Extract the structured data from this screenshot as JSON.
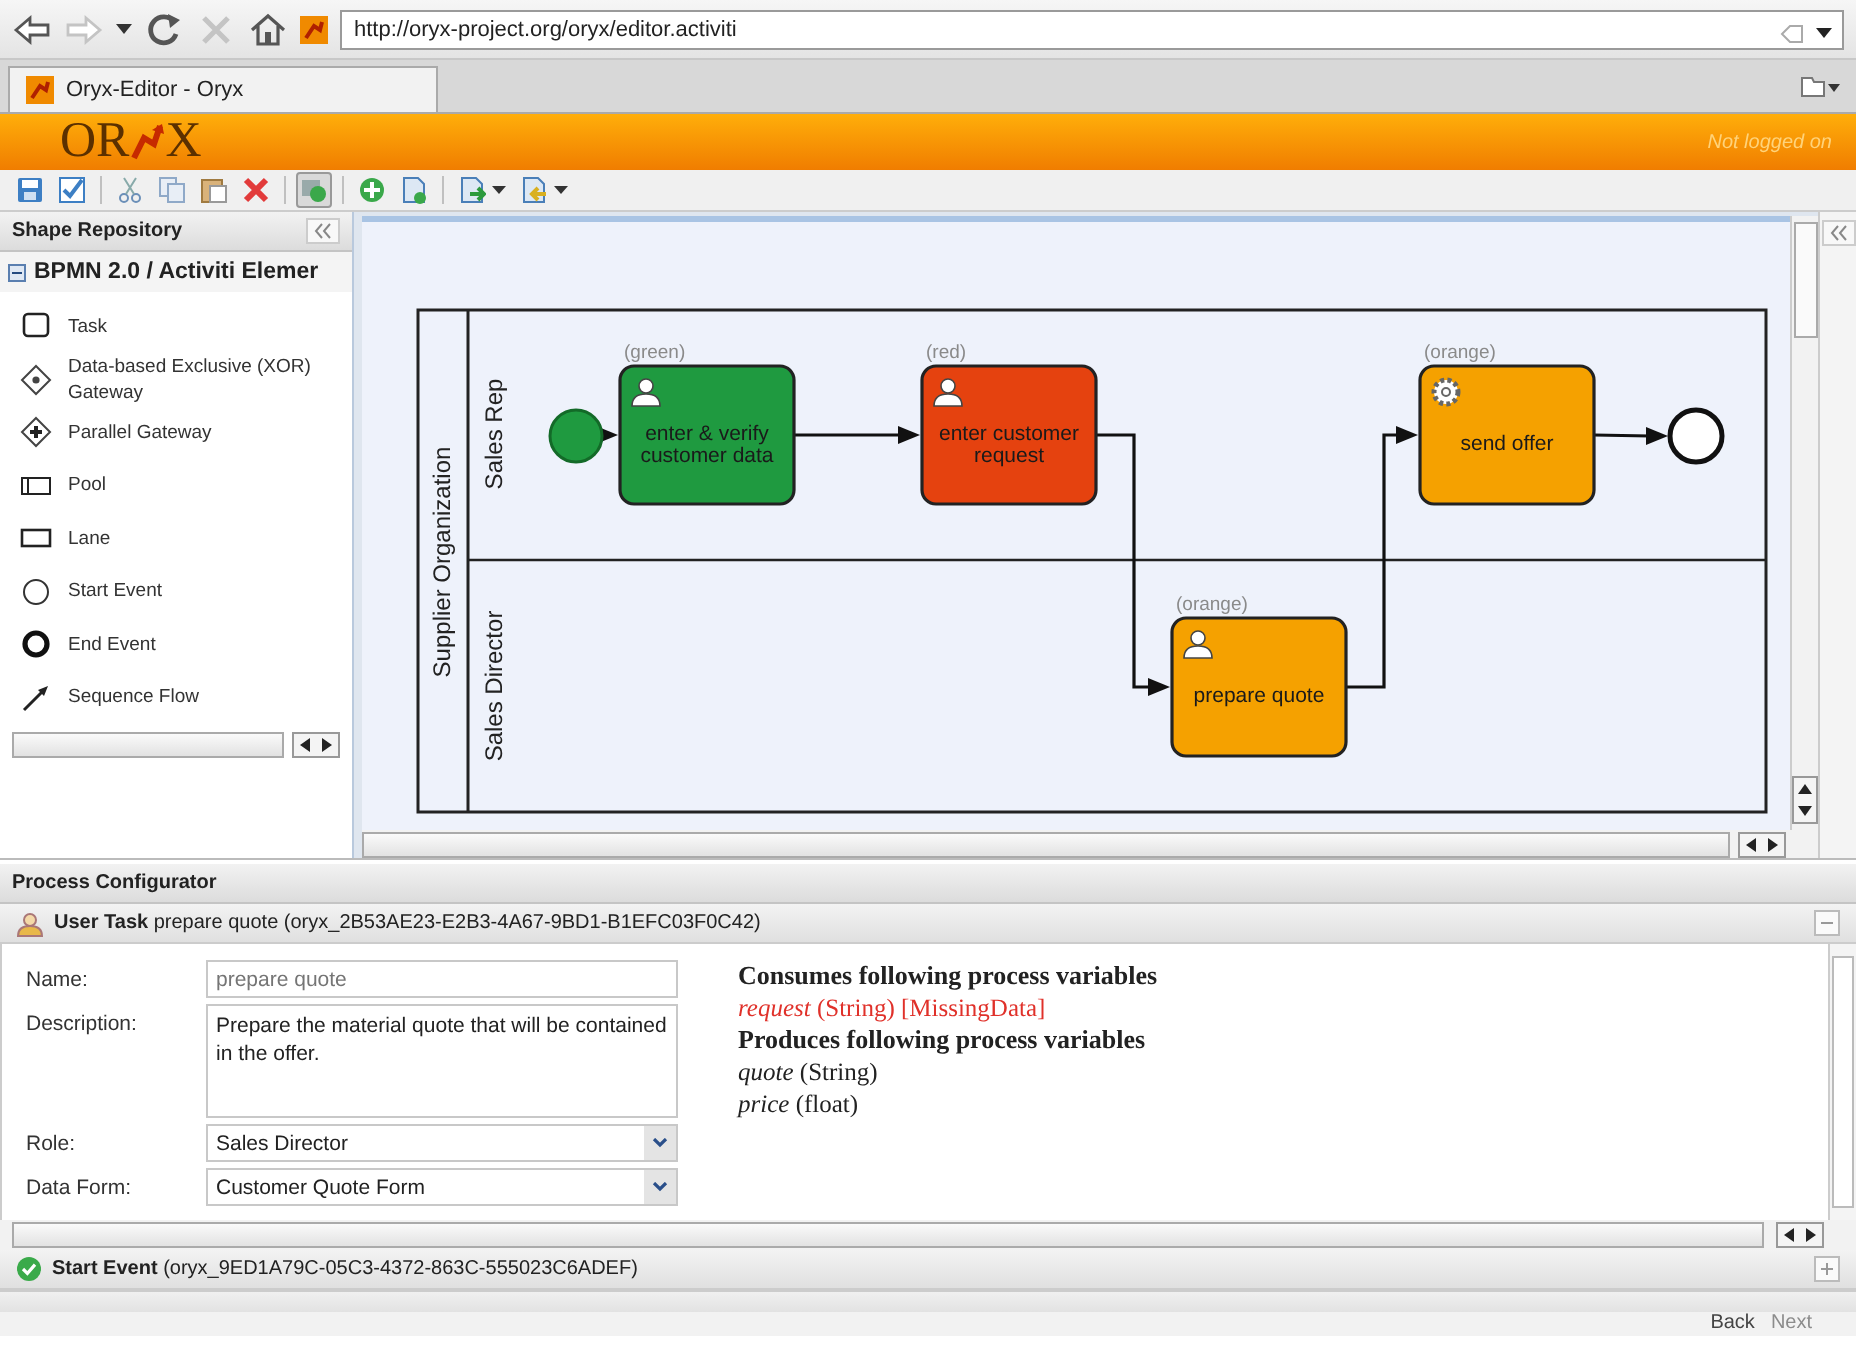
{
  "browser": {
    "nav": [
      {
        "kind": "back",
        "disabled": false
      },
      {
        "kind": "forward",
        "disabled": true
      },
      {
        "kind": "history",
        "disabled": false
      },
      {
        "kind": "reload",
        "disabled": false
      },
      {
        "kind": "stop",
        "disabled": true
      },
      {
        "kind": "home",
        "disabled": false
      }
    ],
    "url": "http://oryx-project.org/oryx/editor.activiti",
    "tabs": [
      {
        "title": "Oryx-Editor - Oryx",
        "selected": true
      }
    ]
  },
  "header": {
    "logo_left": "OR",
    "logo_right": "X",
    "login_status": "Not logged on"
  },
  "toolbar": [
    {
      "kind": "save",
      "selected": false
    },
    {
      "kind": "edit",
      "selected": false
    },
    {
      "kind": "cut",
      "selected": false
    },
    {
      "kind": "copy",
      "selected": false
    },
    {
      "kind": "paste",
      "selected": false
    },
    {
      "kind": "delete",
      "selected": false
    },
    {
      "kind": "shapes",
      "selected": true
    },
    {
      "kind": "add",
      "selected": false
    },
    {
      "kind": "document",
      "selected": false
    },
    {
      "kind": "export",
      "selected": false
    },
    {
      "kind": "import",
      "selected": false
    }
  ],
  "shape_repository": {
    "title": "Shape Repository",
    "group": {
      "title": "BPMN 2.0 / Activiti Elemer",
      "expanded": true
    },
    "items": [
      {
        "kind": "task",
        "label": "Task"
      },
      {
        "kind": "xor",
        "label": "Data-based Exclusive (XOR) Gateway"
      },
      {
        "kind": "parallel",
        "label": "Parallel Gateway"
      },
      {
        "kind": "pool",
        "label": "Pool"
      },
      {
        "kind": "lane",
        "label": "Lane"
      },
      {
        "kind": "start",
        "label": "Start Event"
      },
      {
        "kind": "end",
        "label": "End Event"
      },
      {
        "kind": "flow",
        "label": "Sequence Flow"
      }
    ]
  },
  "diagram": {
    "pool": "Supplier Organization",
    "lanes": [
      "Sales Rep",
      "Sales Director"
    ],
    "nodes": [
      {
        "kind": "start_event"
      },
      {
        "kind": "user_task",
        "label": "enter & verify customer data",
        "note": "(green)",
        "color": "#1f9a40"
      },
      {
        "kind": "user_task",
        "label": "enter customer request",
        "note": "(red)",
        "color": "#e5420f"
      },
      {
        "kind": "service_task",
        "label": "send offer",
        "note": "(orange)",
        "color": "#f5a100"
      },
      {
        "kind": "user_task",
        "label": "prepare quote",
        "note": "(orange)",
        "color": "#f5a100"
      },
      {
        "kind": "end_event"
      }
    ]
  },
  "configurator": {
    "title": "Process Configurator",
    "section": {
      "heading": "**User Task** prepare quote (oryx_2B53AE23-E2B3-4A67-9BD1-B1EFC03F0C42)",
      "expanded": true
    },
    "fields": [
      {
        "kind": "text",
        "label": "Name:",
        "placeholder": "prepare quote"
      },
      {
        "kind": "textarea",
        "label": "Description:",
        "value": "Prepare the material quote that will be contained in the offer."
      },
      {
        "kind": "select",
        "label": "Role:",
        "value": "Sales Director"
      },
      {
        "kind": "select",
        "label": "Data Form:",
        "value": "Customer Quote Form"
      }
    ],
    "variables": {
      "consumes_title": "Consumes following process variables",
      "consumes": [
        {
          "name": "request",
          "type": "(String)",
          "missing": "[MissingData]"
        }
      ],
      "produces_title": "Produces following process variables",
      "produces": [
        {
          "name": "quote",
          "type": "(String)"
        },
        {
          "name": "price",
          "type": "(float)"
        }
      ]
    },
    "other_sections": [
      {
        "heading": "**Start Event** (oryx_9ED1A79C-05C3-4372-863C-555023C6ADEF)",
        "expanded": false
      }
    ]
  },
  "footer": {
    "back": "Back",
    "next": "Next",
    "next_disabled": true
  }
}
